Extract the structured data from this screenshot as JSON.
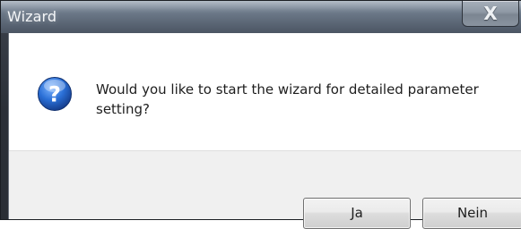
{
  "window": {
    "title": "Wizard",
    "close_icon_glyph": "X"
  },
  "dialog": {
    "icon": "question-icon",
    "message": "Would you like to start the wizard for detailed parameter setting?"
  },
  "buttons": {
    "yes_label": "Ja",
    "no_label": "Nein"
  },
  "colors": {
    "titlebar": "#6f7c8c",
    "icon_blue": "#1f5fbf",
    "button_bg": "#e5e5e5"
  }
}
